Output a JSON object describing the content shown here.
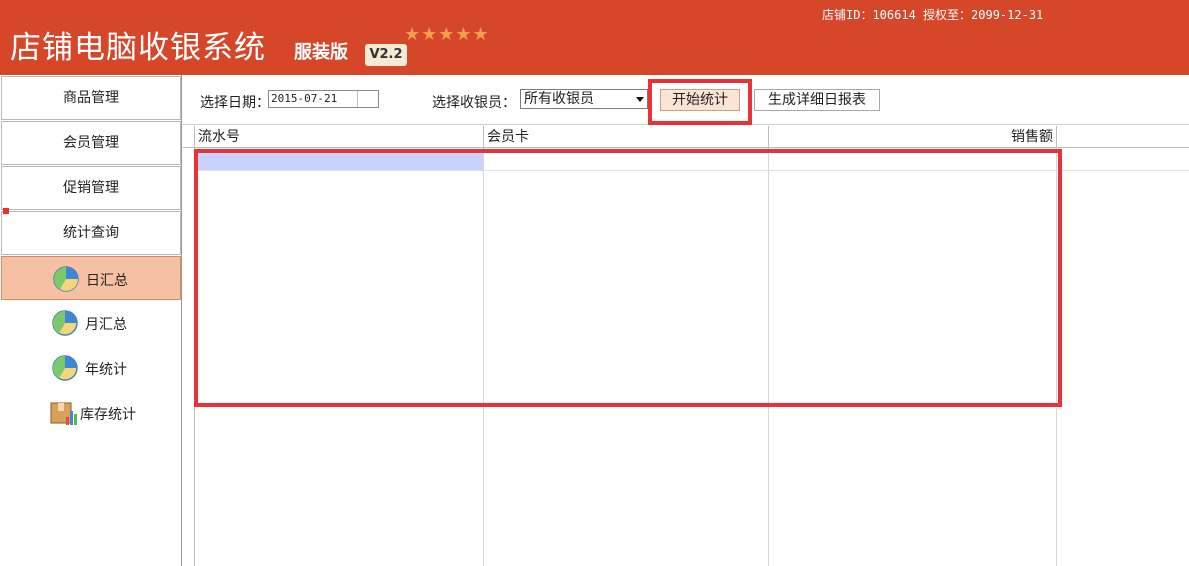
{
  "header": {
    "title": "店铺电脑收银系统",
    "edition": "服装版",
    "version": "V2.2",
    "stars": "★★★★★",
    "store_info": "店铺ID：106614 授权至：2099-12-31"
  },
  "sidebar": {
    "items": [
      {
        "label": "商品管理",
        "icon": "none"
      },
      {
        "label": "会员管理",
        "icon": "none"
      },
      {
        "label": "促销管理",
        "icon": "none"
      },
      {
        "label": "统计查询",
        "icon": "none"
      }
    ],
    "sub_items": [
      {
        "label": "日汇总",
        "icon": "pie-chart-icon",
        "active": true
      },
      {
        "label": "月汇总",
        "icon": "pie-chart-icon",
        "active": false
      },
      {
        "label": "年统计",
        "icon": "pie-chart-icon",
        "active": false
      },
      {
        "label": "库存统计",
        "icon": "inventory-chart-icon",
        "active": false
      }
    ]
  },
  "toolbar": {
    "date_label": "选择日期：",
    "date_value": "2015-07-21",
    "cashier_label": "选择收银员：",
    "cashier_selected": "所有收银员",
    "start_button": "开始统计",
    "report_button": "生成详细日报表"
  },
  "grid": {
    "columns": [
      "流水号",
      "会员卡",
      "销售额"
    ],
    "rows": []
  },
  "colors": {
    "header_bg": "#d6472a",
    "active_item_bg": "#f6c0a2",
    "highlight_box": "#e83238",
    "selected_cell": "#c8d2ff"
  }
}
